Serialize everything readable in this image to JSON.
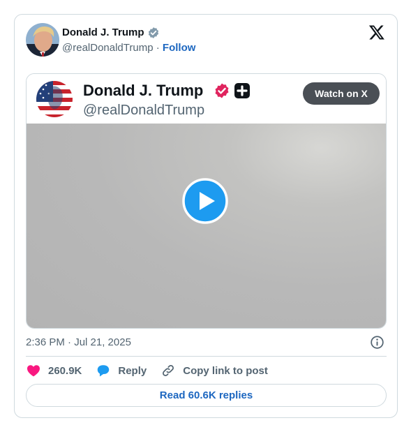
{
  "author": {
    "name": "Donald J. Trump",
    "handle": "@realDonaldTrump",
    "separator": "·",
    "follow_label": "Follow",
    "verified_icon": "verified-badge-icon"
  },
  "header_logo": "x-logo-icon",
  "media": {
    "name": "Donald J. Trump",
    "handle": "@realDonaldTrump",
    "watch_label": "Watch on X",
    "play_icon": "play-icon"
  },
  "meta": {
    "timestamp": "2:36 PM · Jul 21, 2025"
  },
  "actions": {
    "likes": "260.9K",
    "reply_label": "Reply",
    "copy_label": "Copy link to post"
  },
  "read_replies_label": "Read 60.6K replies",
  "colors": {
    "link": "#1d67c0",
    "like_heart": "#f91880",
    "reply_bubble": "#1d9bf0",
    "verified_gray": "#829aab",
    "verified_red": "#e0245e",
    "border": "#cfd9de",
    "muted_text": "#536471"
  }
}
